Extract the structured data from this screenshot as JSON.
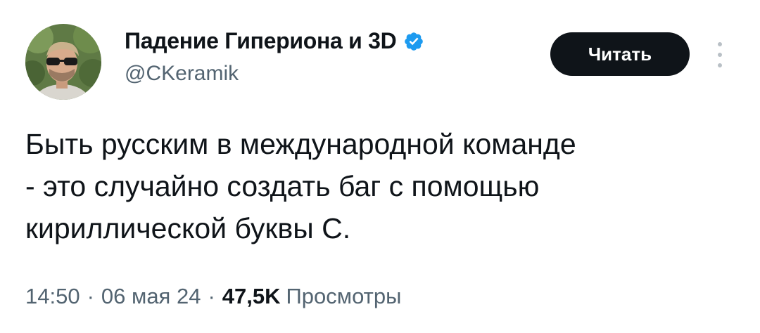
{
  "author": {
    "display_name": "Падение Гипериона и 3D",
    "handle": "@CKeramik",
    "verified_icon": "verified-badge-icon",
    "verified_color": "#1d9bf0"
  },
  "follow_button": {
    "label": "Читать"
  },
  "more_menu": {
    "icon": "more-vertical-icon"
  },
  "tweet": {
    "lines": [
      "Быть русским в международной команде",
      "- это случайно создать баг с помощью",
      "кириллической буквы С."
    ]
  },
  "meta": {
    "time": "14:50",
    "separator": "·",
    "date": "06 мая 24",
    "views_count": "47,5K",
    "views_label": "Просмотры"
  },
  "colors": {
    "text_primary": "#0f1419",
    "text_secondary": "#536471",
    "button_bg": "#0f1419"
  }
}
